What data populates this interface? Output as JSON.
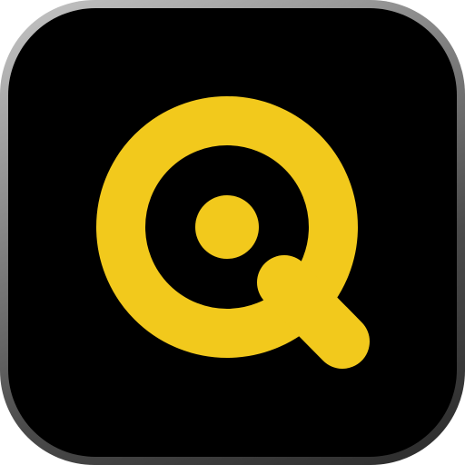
{
  "app_icon": {
    "icon_name": "magnifier-q-logo-icon",
    "colors": {
      "background": "#000000",
      "bezel": "#8e8e8e",
      "logo": "#f2c91c"
    }
  }
}
